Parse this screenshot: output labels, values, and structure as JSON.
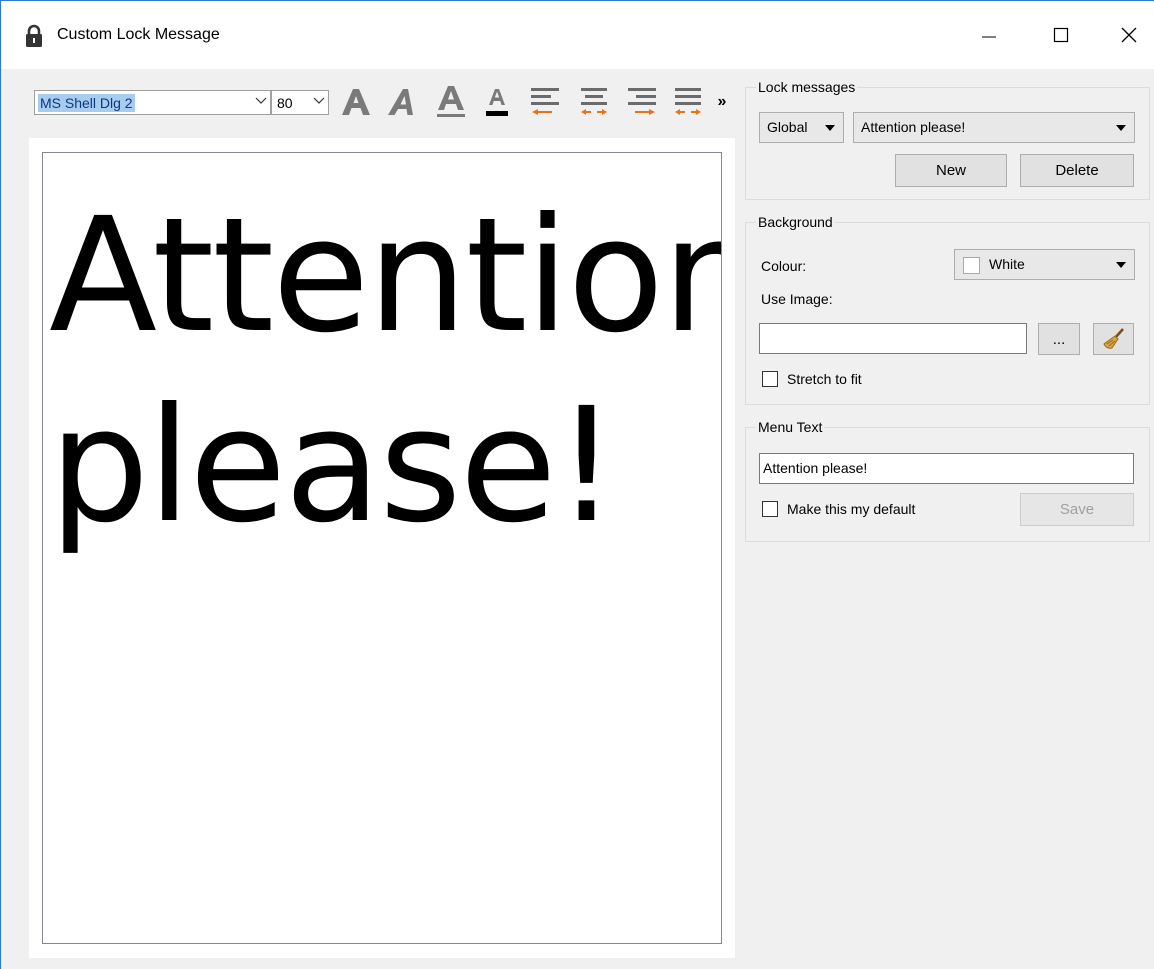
{
  "window": {
    "title": "Custom Lock Message"
  },
  "toolbar": {
    "font_name": "MS Shell Dlg 2",
    "font_size": "80",
    "more": "»",
    "icons": [
      "bold-icon",
      "italic-icon",
      "underline-icon",
      "font-color-icon",
      "align-left-icon",
      "align-center-icon",
      "align-right-icon",
      "justify-icon"
    ]
  },
  "editor": {
    "text": "Attention please!"
  },
  "lock_messages": {
    "title": "Lock messages",
    "scope": "Global",
    "selected": "Attention please!",
    "new_label": "New",
    "delete_label": "Delete"
  },
  "background": {
    "title": "Background",
    "colour_label": "Colour:",
    "colour_value": "White",
    "use_image_label": "Use Image:",
    "image_path": "",
    "browse_label": "...",
    "stretch_label": "Stretch to fit",
    "stretch_checked": false
  },
  "menu_text": {
    "title": "Menu Text",
    "value": "Attention please!",
    "default_label": "Make this my default",
    "default_checked": false,
    "save_label": "Save"
  },
  "colors": {
    "accent_orange": "#e8731a",
    "selection": "#a8cbf0",
    "window_bg": "#f0f0f0"
  }
}
